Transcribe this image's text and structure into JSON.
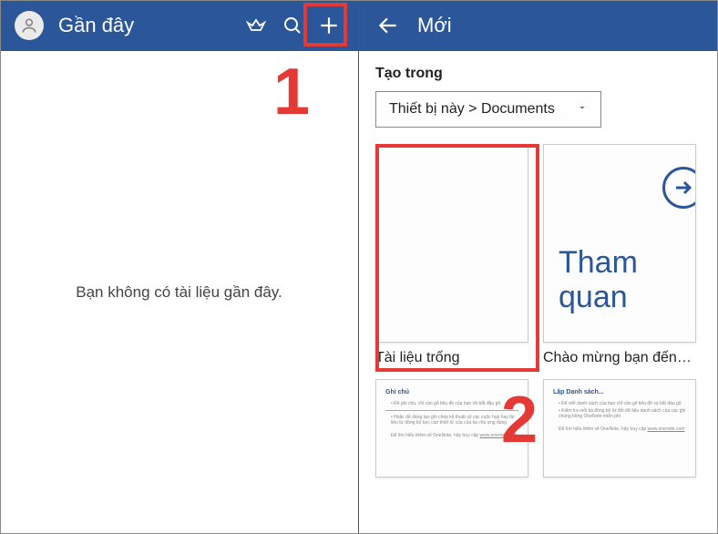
{
  "left": {
    "title": "Gần đây",
    "emptyMessage": "Bạn không có tài liệu gần đây."
  },
  "right": {
    "title": "Mới",
    "createInLabel": "Tạo trong",
    "dropdownValue": "Thiết bị này > Documents",
    "templates": [
      {
        "label": "Tài liệu trống"
      },
      {
        "label": "Chào mừng bạn đến…",
        "tourText": "Tham quan"
      }
    ],
    "row2": [
      {
        "heading": "Ghi chú"
      },
      {
        "heading": "Lập Danh sách..."
      }
    ]
  },
  "callouts": {
    "one": "1",
    "two": "2"
  }
}
